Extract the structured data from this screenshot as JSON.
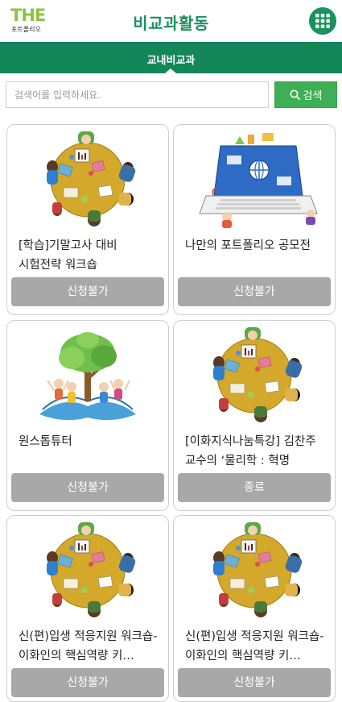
{
  "header": {
    "logo_word": "THE",
    "logo_sub": "포트폴리오",
    "title": "비교과활동",
    "menu_icon": "grid-menu-icon"
  },
  "tabs": [
    {
      "label": "교내비교과",
      "active": true
    }
  ],
  "search": {
    "value": "",
    "placeholder": "검색어를 입력하세요.",
    "button_label": "검색",
    "button_icon": "search-icon"
  },
  "colors": {
    "brand_green": "#13875a",
    "title_green": "#1a9160",
    "search_button": "#3eae57",
    "status_button": "#a8a8a8"
  },
  "programs": [
    {
      "title": "[학습]기말고사 대비 시험전략 워크숍",
      "status": "신청불가",
      "image": "study-group-illustration"
    },
    {
      "title": "나만의 포트폴리오 공모전",
      "status": "신청불가",
      "image": "laptop-portfolio-illustration"
    },
    {
      "title": "원스톱튜터",
      "status": "신청불가",
      "image": "tree-kids-illustration"
    },
    {
      "title": "[이화지식나눔특강] 김찬주 교수의 ‘물리학 : 혁명",
      "status": "종료",
      "image": "study-group-illustration"
    },
    {
      "title": "신(편)입생 적응지원 워크숍-이화인의 핵심역량 키…",
      "status": "신청불가",
      "image": "study-group-illustration"
    },
    {
      "title": "신(편)입생 적응지원 워크숍-이화인의 핵심역량 키…",
      "status": "신청불가",
      "image": "study-group-illustration"
    }
  ]
}
